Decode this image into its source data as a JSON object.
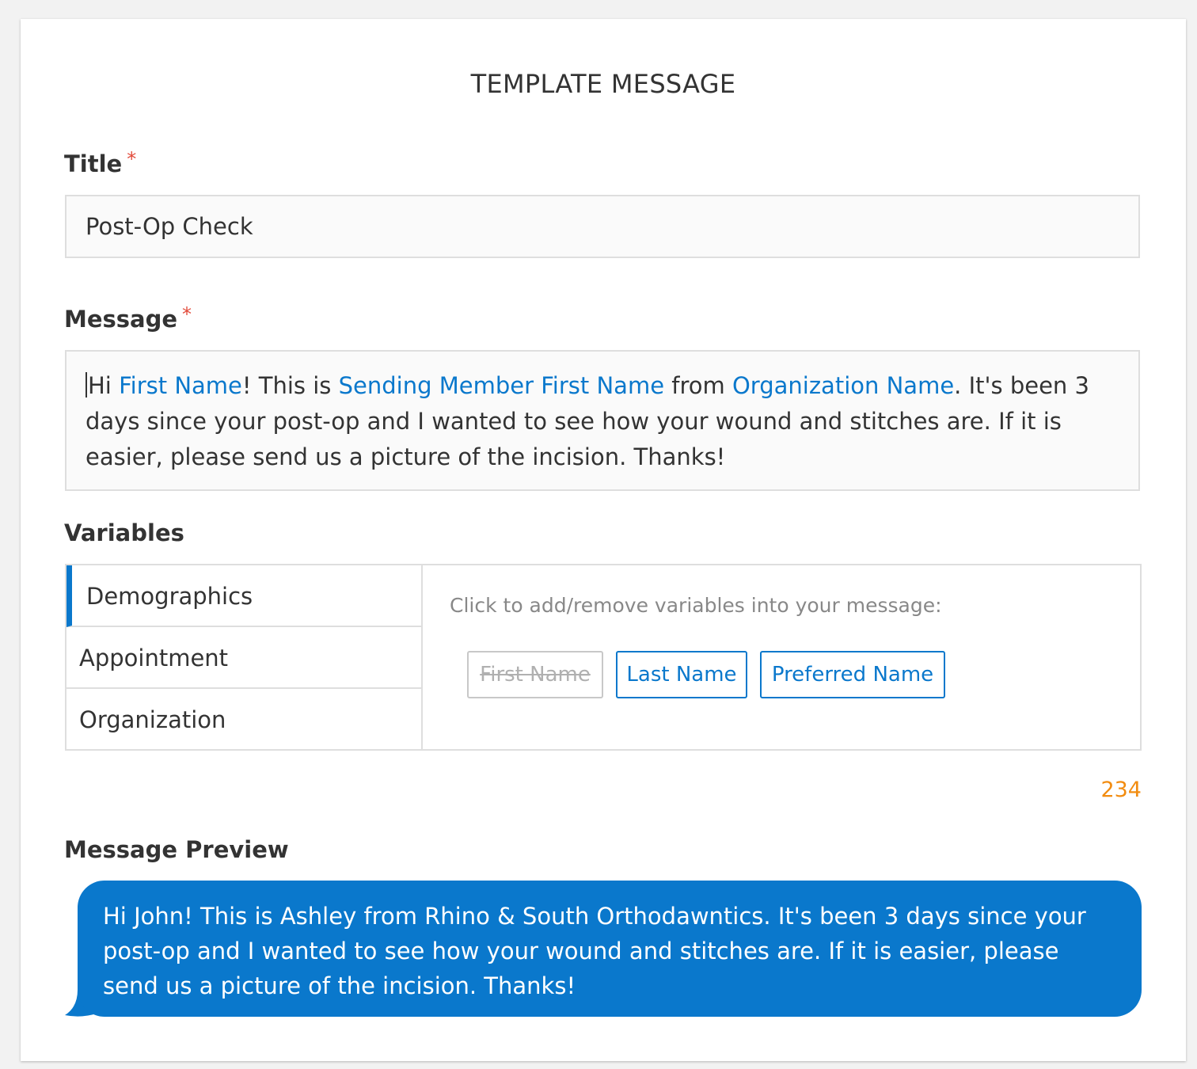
{
  "page": {
    "title": "TEMPLATE MESSAGE"
  },
  "title_field": {
    "label": "Title",
    "required_mark": "*",
    "value": "Post-Op Check"
  },
  "message_field": {
    "label": "Message",
    "required_mark": "*",
    "segments": [
      {
        "text": "Hi ",
        "type": "text"
      },
      {
        "text": "First Name",
        "type": "variable"
      },
      {
        "text": "! This is ",
        "type": "text"
      },
      {
        "text": "Sending Member First Name",
        "type": "variable"
      },
      {
        "text": " from ",
        "type": "text"
      },
      {
        "text": "Organization Name",
        "type": "variable"
      },
      {
        "text": ". It's been 3 days since your post-op and I wanted to see how your wound and stitches are. If it is easier, please send us a picture of the incision. Thanks!",
        "type": "text"
      }
    ]
  },
  "variables": {
    "label": "Variables",
    "tabs": [
      {
        "label": "Demographics",
        "active": true
      },
      {
        "label": "Appointment",
        "active": false
      },
      {
        "label": "Organization",
        "active": false
      }
    ],
    "hint": "Click to add/remove variables into your message:",
    "chips": [
      {
        "label": "First Name",
        "used": true
      },
      {
        "label": "Last Name",
        "used": false
      },
      {
        "label": "Preferred Name",
        "used": false
      }
    ]
  },
  "char_count": "234",
  "preview": {
    "label": "Message Preview",
    "text": "Hi John! This is Ashley from Rhino & South Orthodawntics. It's been 3 days since your post-op and I wanted to see how your wound and stitches are. If it is easier, please send us a picture of the incision. Thanks!"
  },
  "colors": {
    "accent": "#0a78cc",
    "required": "#e24b3b",
    "count": "#f28c10"
  }
}
